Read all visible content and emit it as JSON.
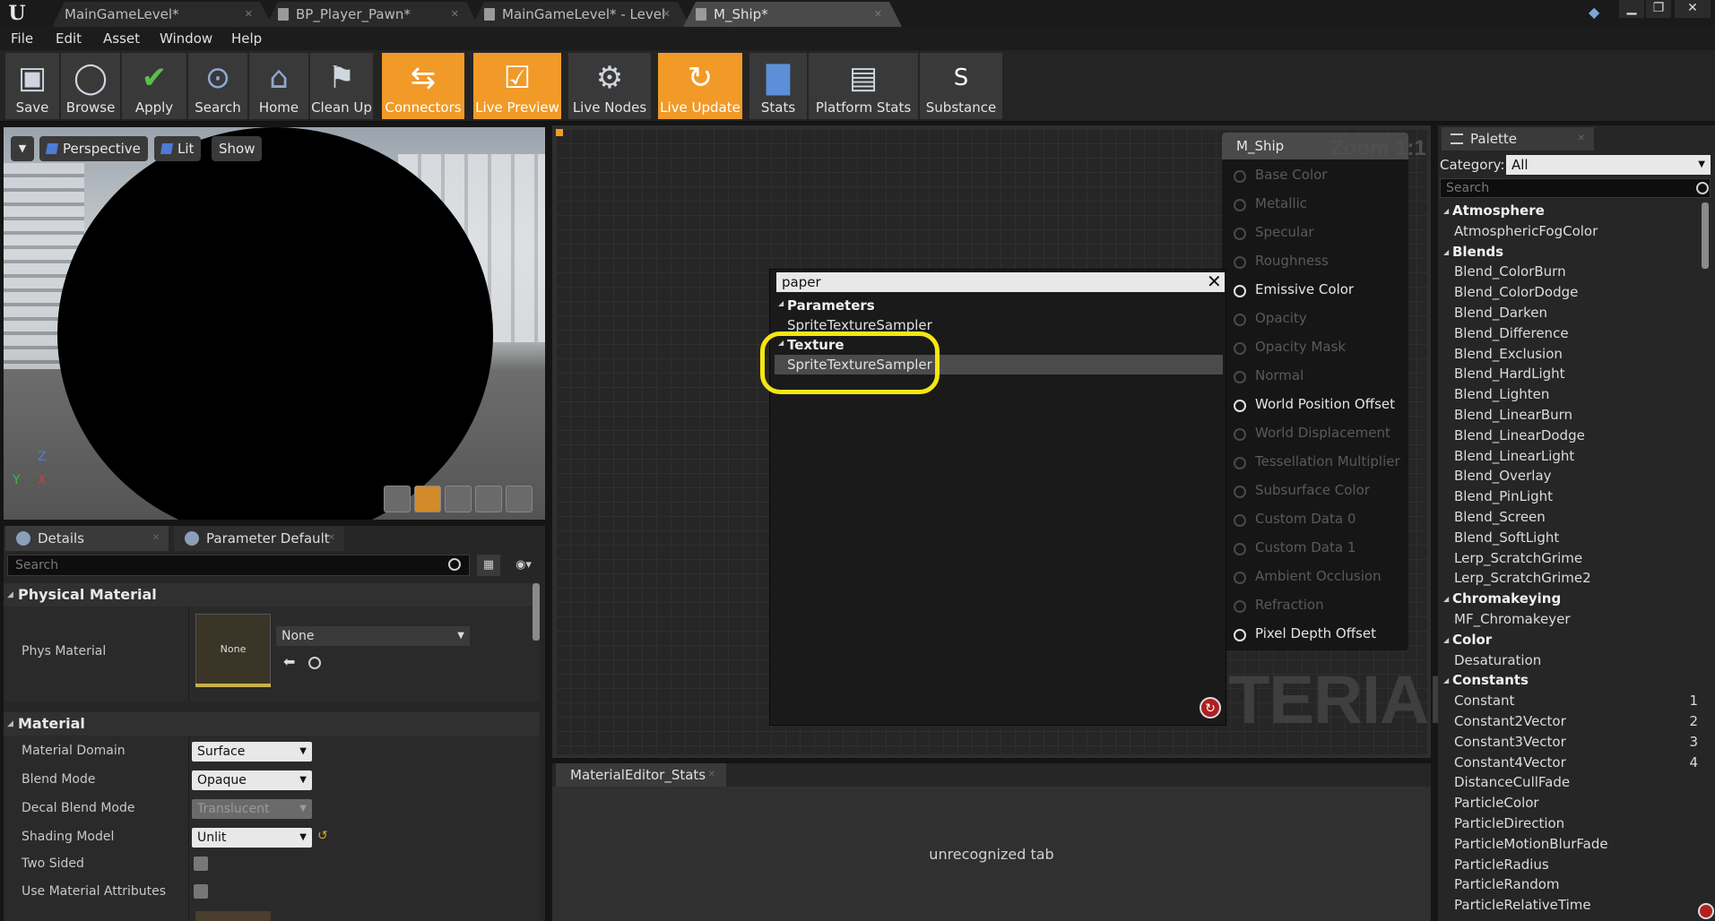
{
  "tabs": [
    {
      "label": "MainGameLevel*",
      "active": false
    },
    {
      "label": "BP_Player_Pawn*",
      "active": false
    },
    {
      "label": "MainGameLevel* - Level",
      "active": false
    },
    {
      "label": "M_Ship*",
      "active": true
    }
  ],
  "menu": [
    "File",
    "Edit",
    "Asset",
    "Window",
    "Help"
  ],
  "toolbar": [
    {
      "label": "Save",
      "icon": "save-icon",
      "active": false
    },
    {
      "label": "Browse",
      "icon": "magnifier-icon",
      "active": false
    },
    {
      "label": "Apply",
      "icon": "checkmark-icon",
      "active": false
    },
    {
      "label": "Search",
      "icon": "binoculars-icon",
      "active": false
    },
    {
      "label": "Home",
      "icon": "home-icon",
      "active": false
    },
    {
      "label": "Clean Up",
      "icon": "broom-icon",
      "active": false
    },
    {
      "label": "Connectors",
      "icon": "connectors-icon",
      "active": true
    },
    {
      "label": "Live Preview",
      "icon": "live-preview-icon",
      "active": true
    },
    {
      "label": "Live Nodes",
      "icon": "live-nodes-icon",
      "active": false
    },
    {
      "label": "Live Update",
      "icon": "live-update-icon",
      "active": true
    },
    {
      "label": "Stats",
      "icon": "bar-chart-icon",
      "active": false
    },
    {
      "label": "Platform Stats",
      "icon": "platform-stats-icon",
      "active": false
    },
    {
      "label": "Substance",
      "icon": "substance-icon",
      "active": false
    }
  ],
  "viewport": {
    "perspective": "Perspective",
    "lit": "Lit",
    "show": "Show",
    "axis_z": "Z",
    "axis_x": "X",
    "axis_y": "Y"
  },
  "details": {
    "tab_details": "Details",
    "tab_params": "Parameter Default",
    "search_placeholder": "Search",
    "section_physical": "Physical Material",
    "phys_label": "Phys Material",
    "phys_thumb": "None",
    "phys_value": "None",
    "section_material": "Material",
    "props": [
      {
        "label": "Material Domain",
        "value": "Surface",
        "disabled": false
      },
      {
        "label": "Blend Mode",
        "value": "Opaque",
        "disabled": false
      },
      {
        "label": "Decal Blend Mode",
        "value": "Translucent",
        "disabled": true
      },
      {
        "label": "Shading Model",
        "value": "Unlit",
        "disabled": false
      },
      {
        "label": "Two Sided",
        "checkbox": true
      },
      {
        "label": "Use Material Attributes",
        "checkbox": true
      }
    ]
  },
  "graph": {
    "node_title": "M_Ship",
    "zoom": "Zoom 1:1",
    "watermark": "TERIAL",
    "pins": [
      {
        "label": "Base Color",
        "active": false
      },
      {
        "label": "Metallic",
        "active": false
      },
      {
        "label": "Specular",
        "active": false
      },
      {
        "label": "Roughness",
        "active": false
      },
      {
        "label": "Emissive Color",
        "active": true
      },
      {
        "label": "Opacity",
        "active": false
      },
      {
        "label": "Opacity Mask",
        "active": false
      },
      {
        "label": "Normal",
        "active": false
      },
      {
        "label": "World Position Offset",
        "active": true
      },
      {
        "label": "World Displacement",
        "active": false
      },
      {
        "label": "Tessellation Multiplier",
        "active": false
      },
      {
        "label": "Subsurface Color",
        "active": false
      },
      {
        "label": "Custom Data 0",
        "active": false
      },
      {
        "label": "Custom Data 1",
        "active": false
      },
      {
        "label": "Ambient Occlusion",
        "active": false
      },
      {
        "label": "Refraction",
        "active": false
      },
      {
        "label": "Pixel Depth Offset",
        "active": true
      }
    ]
  },
  "search_popup": {
    "query": "paper",
    "cat_params": "Parameters",
    "item_params": "SpriteTextureSampler",
    "cat_texture": "Texture",
    "item_texture": "SpriteTextureSampler"
  },
  "stats": {
    "tab": "MaterialEditor_Stats",
    "message": "unrecognized tab"
  },
  "palette": {
    "tab": "Palette",
    "category_label": "Category:",
    "category_value": "All",
    "search_placeholder": "Search",
    "rows": [
      {
        "label": "Atmosphere",
        "group": true
      },
      {
        "label": "AtmosphericFogColor"
      },
      {
        "label": "Blends",
        "group": true
      },
      {
        "label": "Blend_ColorBurn"
      },
      {
        "label": "Blend_ColorDodge"
      },
      {
        "label": "Blend_Darken"
      },
      {
        "label": "Blend_Difference"
      },
      {
        "label": "Blend_Exclusion"
      },
      {
        "label": "Blend_HardLight"
      },
      {
        "label": "Blend_Lighten"
      },
      {
        "label": "Blend_LinearBurn"
      },
      {
        "label": "Blend_LinearDodge"
      },
      {
        "label": "Blend_LinearLight"
      },
      {
        "label": "Blend_Overlay"
      },
      {
        "label": "Blend_PinLight"
      },
      {
        "label": "Blend_Screen"
      },
      {
        "label": "Blend_SoftLight"
      },
      {
        "label": "Lerp_ScratchGrime"
      },
      {
        "label": "Lerp_ScratchGrime2"
      },
      {
        "label": "Chromakeying",
        "group": true
      },
      {
        "label": "MF_Chromakeyer"
      },
      {
        "label": "Color",
        "group": true
      },
      {
        "label": "Desaturation"
      },
      {
        "label": "Constants",
        "group": true
      },
      {
        "label": "Constant",
        "hotkey": "1"
      },
      {
        "label": "Constant2Vector",
        "hotkey": "2"
      },
      {
        "label": "Constant3Vector",
        "hotkey": "3"
      },
      {
        "label": "Constant4Vector",
        "hotkey": "4"
      },
      {
        "label": "DistanceCullFade"
      },
      {
        "label": "ParticleColor"
      },
      {
        "label": "ParticleDirection"
      },
      {
        "label": "ParticleMotionBlurFade"
      },
      {
        "label": "ParticleRadius"
      },
      {
        "label": "ParticleRandom"
      },
      {
        "label": "ParticleRelativeTime"
      }
    ]
  },
  "colors": {
    "accent": "#f19a28",
    "highlight": "#f5e612"
  }
}
